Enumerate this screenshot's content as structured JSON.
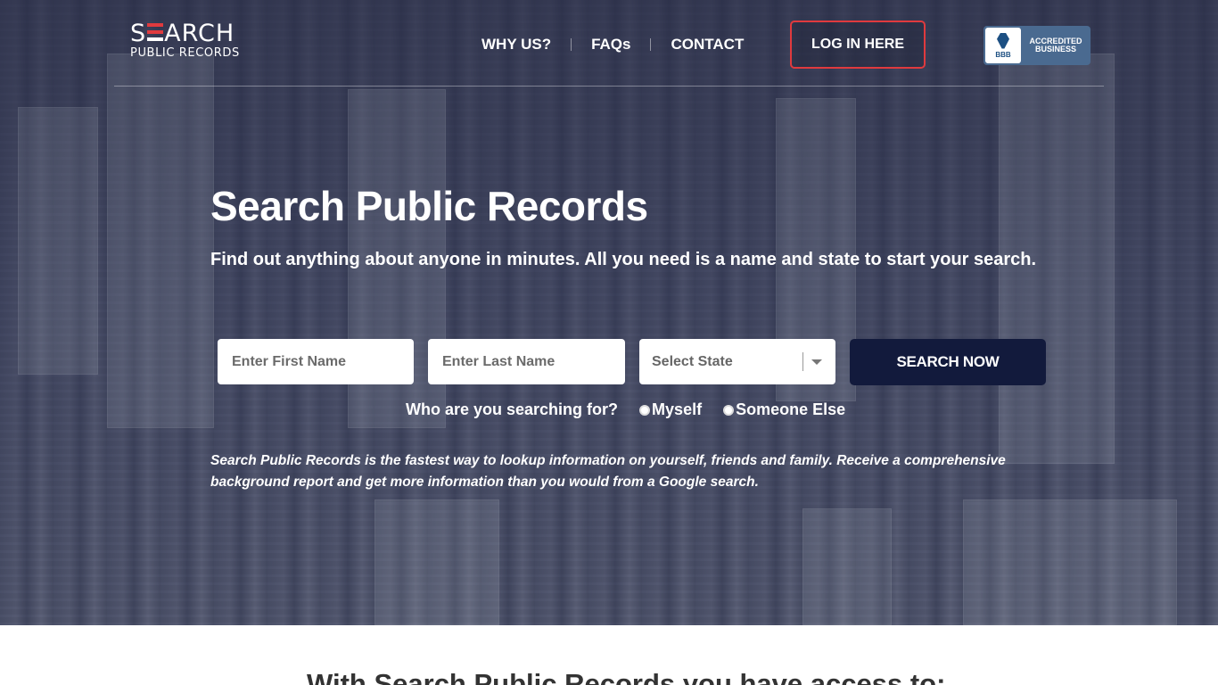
{
  "logo": {
    "line1_s": "S",
    "line1_rest": "ARCH",
    "line2": "PUBLIC RECORDS"
  },
  "nav": {
    "why_us": "WHY US?",
    "faqs": "FAQs",
    "contact": "CONTACT"
  },
  "login": {
    "label": "LOG IN HERE"
  },
  "bbb": {
    "letters": "BBB",
    "line1": "ACCREDITED",
    "line2": "BUSINESS"
  },
  "hero": {
    "title": "Search Public Records",
    "subtitle": "Find out anything about anyone in minutes. All you need is a name and state to start your search.",
    "disclaimer": "Search Public Records is the fastest way to lookup information on yourself, friends and family. Receive a comprehensive background report and get more information than you would from a Google search."
  },
  "form": {
    "first_name_placeholder": "Enter First Name",
    "last_name_placeholder": "Enter Last Name",
    "state_selected": "Select State",
    "submit_label": "SEARCH NOW",
    "question": "Who are you searching for?",
    "option_myself": "Myself",
    "option_someone": "Someone Else"
  },
  "section": {
    "title": "With Search Public Records you have access to:"
  },
  "colors": {
    "accent_red": "#e03a3e",
    "navy": "#121a3c"
  }
}
